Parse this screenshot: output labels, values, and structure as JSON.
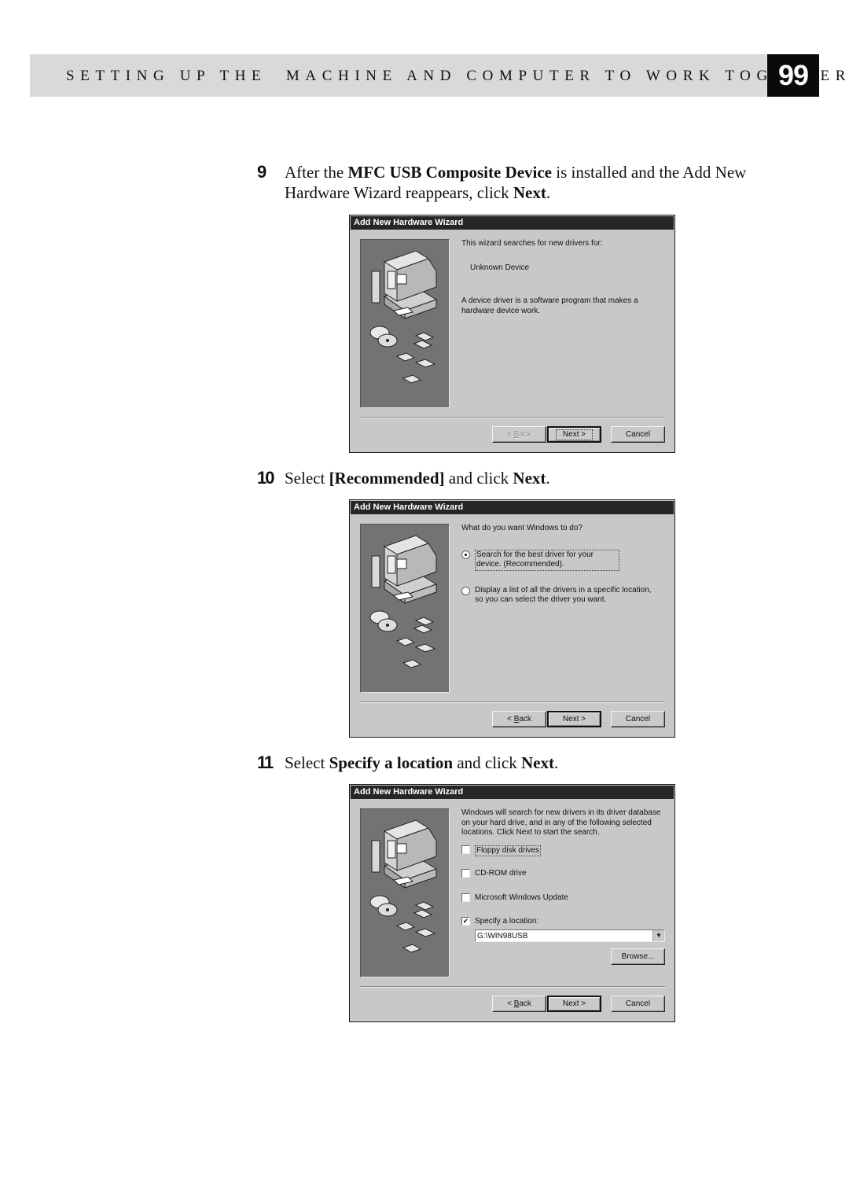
{
  "header": {
    "title": "SETTING UP THE  MACHINE AND COMPUTER TO WORK TOGETHER",
    "page_number": "99"
  },
  "steps": [
    {
      "number": "9",
      "text_parts": [
        "After the ",
        "MFC USB Composite Device",
        " is installed and the Add New Hardware Wizard reappears, click ",
        "Next",
        "."
      ]
    },
    {
      "number": "10",
      "text_parts": [
        "Select ",
        "[Recommended]",
        " and click ",
        "Next",
        "."
      ]
    },
    {
      "number": "11",
      "text_parts": [
        "Select ",
        "Specify a location",
        " and click ",
        "Next",
        "."
      ]
    }
  ],
  "dialogs": [
    {
      "title": "Add New Hardware Wizard",
      "intro": "This wizard searches for new drivers for:",
      "device": "Unknown Device",
      "description": "A device driver is a software program that makes a hardware device work.",
      "buttons": {
        "back": "< Back",
        "next": "Next >",
        "cancel": "Cancel"
      },
      "back_enabled": false
    },
    {
      "title": "Add New Hardware Wizard",
      "question": "What do you want Windows to do?",
      "options": [
        {
          "label": "Search for the best driver for your device. (Recommended).",
          "selected": true
        },
        {
          "label": "Display a list of all the drivers in a specific location, so you can select the driver you want.",
          "selected": false
        }
      ],
      "buttons": {
        "back": "< Back",
        "next": "Next >",
        "cancel": "Cancel"
      }
    },
    {
      "title": "Add New Hardware Wizard",
      "intro": "Windows will search for new drivers in its driver database on your hard drive, and in any of the following selected locations. Click Next to start the search.",
      "checkboxes": [
        {
          "label": "Floppy disk drives",
          "checked": false
        },
        {
          "label": "CD-ROM drive",
          "checked": false
        },
        {
          "label": "Microsoft Windows Update",
          "checked": false
        },
        {
          "label": "Specify a location:",
          "checked": true
        }
      ],
      "location_value": "G:\\WIN98USB",
      "browse_label": "Browse...",
      "buttons": {
        "back": "< Back",
        "next": "Next >",
        "cancel": "Cancel"
      }
    }
  ],
  "icons": {
    "wizard_art": "computer-with-disks-illustration",
    "dropdown": "chevron-down-icon",
    "check": "checkmark-icon"
  }
}
